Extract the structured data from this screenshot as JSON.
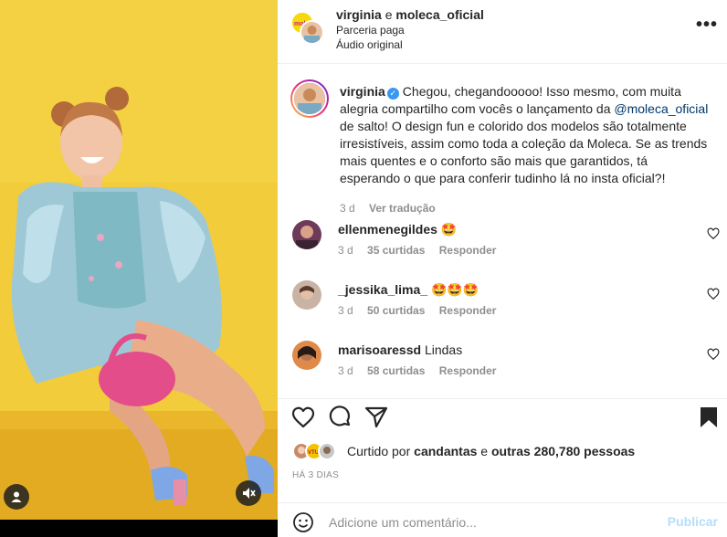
{
  "media": {
    "background_color": "#f2cc3a",
    "tag_icon": "person-tag-icon",
    "mute_icon": "speaker-muted-icon"
  },
  "header": {
    "author1": "virginia",
    "joiner": "e",
    "author2": "moleca_oficial",
    "paid_partnership": "Parceria paga",
    "audio": "Áudio original",
    "more_icon": "more-dots-icon",
    "more_label": "•••"
  },
  "caption": {
    "username": "virginia",
    "verified_icon": "verified-badge-icon",
    "verified_label": "✓",
    "text_before_mention": "Chegou, chegandooooo! Isso mesmo, com muita alegria compartilho com vocês o lançamento da ",
    "mention": "@moleca_oficial",
    "text_after_mention": " de salto! O design fun e colorido dos modelos são totalmente irresistíveis, assim como toda a coleção da Moleca. Se as trends mais quentes e o conforto são mais que garantidos, tá esperando o que para conferir tudinho lá no insta oficial?!",
    "time": "3 d",
    "translate": "Ver tradução"
  },
  "comments": [
    {
      "username": "ellenmenegildes",
      "text": "🤩",
      "time": "3 d",
      "likes": "35 curtidas",
      "reply": "Responder"
    },
    {
      "username": "_jessika_lima_",
      "text": "🤩🤩🤩",
      "time": "3 d",
      "likes": "50 curtidas",
      "reply": "Responder"
    },
    {
      "username": "marisoaressd",
      "text": "Lindas",
      "time": "3 d",
      "likes": "58 curtidas",
      "reply": "Responder"
    }
  ],
  "actions": {
    "like_icon": "heart-icon",
    "comment_icon": "comment-bubble-icon",
    "share_icon": "paper-plane-icon",
    "save_icon": "bookmark-icon"
  },
  "likes": {
    "prefix": "Curtido por",
    "first_user": "candantas",
    "joiner": "e",
    "others": "outras 280,780 pessoas"
  },
  "date": "HÁ 3 DIAS",
  "add_comment": {
    "emoji_icon": "smiley-icon",
    "placeholder": "Adicione um comentário...",
    "publish": "Publicar"
  },
  "colors": {
    "link": "#00376b",
    "verified": "#3897f0",
    "publish_disabled": "#b2dffc",
    "meta_gray": "#8e8e8e"
  }
}
